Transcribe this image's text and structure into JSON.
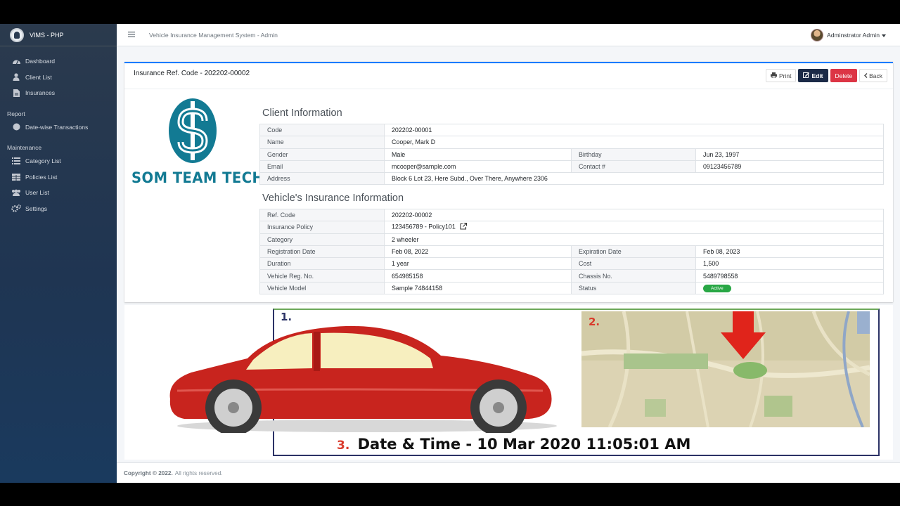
{
  "brand": {
    "name": "VIMS - PHP",
    "logo_icon": "user-avatar-icon"
  },
  "sidebar": {
    "items": [
      {
        "label": "Dashboard",
        "icon": "dashboard-icon"
      },
      {
        "label": "Client List",
        "icon": "user-icon"
      },
      {
        "label": "Insurances",
        "icon": "file-icon"
      }
    ],
    "report_header": "Report",
    "report_items": [
      {
        "label": "Date-wise Transactions",
        "icon": "circle-icon"
      }
    ],
    "maintenance_header": "Maintenance",
    "maintenance_items": [
      {
        "label": "Category List",
        "icon": "list-icon"
      },
      {
        "label": "Policies List",
        "icon": "table-icon"
      },
      {
        "label": "User List",
        "icon": "users-icon"
      },
      {
        "label": "Settings",
        "icon": "cogs-icon"
      }
    ]
  },
  "topbar": {
    "title": "Vehicle Insurance Management System - Admin",
    "user": "Adminstrator Admin"
  },
  "card": {
    "title": "Insurance Ref. Code - 202202-00002",
    "buttons": {
      "print": "Print",
      "edit": "Edit",
      "delete": "Delete",
      "back": "Back"
    }
  },
  "logo_text": "SOM TEAM TECH",
  "client": {
    "heading": "Client Information",
    "code_label": "Code",
    "code": "202202-00001",
    "name_label": "Name",
    "name": "Cooper, Mark D",
    "gender_label": "Gender",
    "gender": "Male",
    "birthday_label": "Birthday",
    "birthday": "Jun 23, 1997",
    "email_label": "Email",
    "email": "mcooper@sample.com",
    "contact_label": "Contact #",
    "contact": "09123456789",
    "address_label": "Address",
    "address": "Block 6 Lot 23, Here Subd., Over There, Anywhere 2306"
  },
  "vehicle": {
    "heading": "Vehicle's Insurance Information",
    "ref_label": "Ref. Code",
    "ref": "202202-00002",
    "policy_label": "Insurance Policy",
    "policy": "123456789 - Policy101",
    "category_label": "Category",
    "category": "2 wheeler",
    "reg_date_label": "Registration Date",
    "reg_date": "Feb 08, 2022",
    "exp_date_label": "Expiration Date",
    "exp_date": "Feb 08, 2023",
    "duration_label": "Duration",
    "duration": "1 year",
    "cost_label": "Cost",
    "cost": "1,500",
    "reg_no_label": "Vehicle Reg. No.",
    "reg_no": "654985158",
    "chassis_label": "Chassis No.",
    "chassis": "5489798558",
    "model_label": "Vehicle Model",
    "model": "Sample 74844158",
    "status_label": "Status",
    "status": "Active"
  },
  "overlay": {
    "label1": "1.",
    "label2": "2.",
    "label3": "3.",
    "caption": "Date & Time - 10 Mar 2020 11:05:01 AM"
  },
  "footer": {
    "copyright": "Copyright © 2022.",
    "rights": "All rights reserved."
  },
  "colors": {
    "accent": "#007bff",
    "sidebar": "#1f3552",
    "danger": "#dc3545",
    "edit": "#1b2a47",
    "active": "#28a745",
    "logo": "#127a93"
  }
}
